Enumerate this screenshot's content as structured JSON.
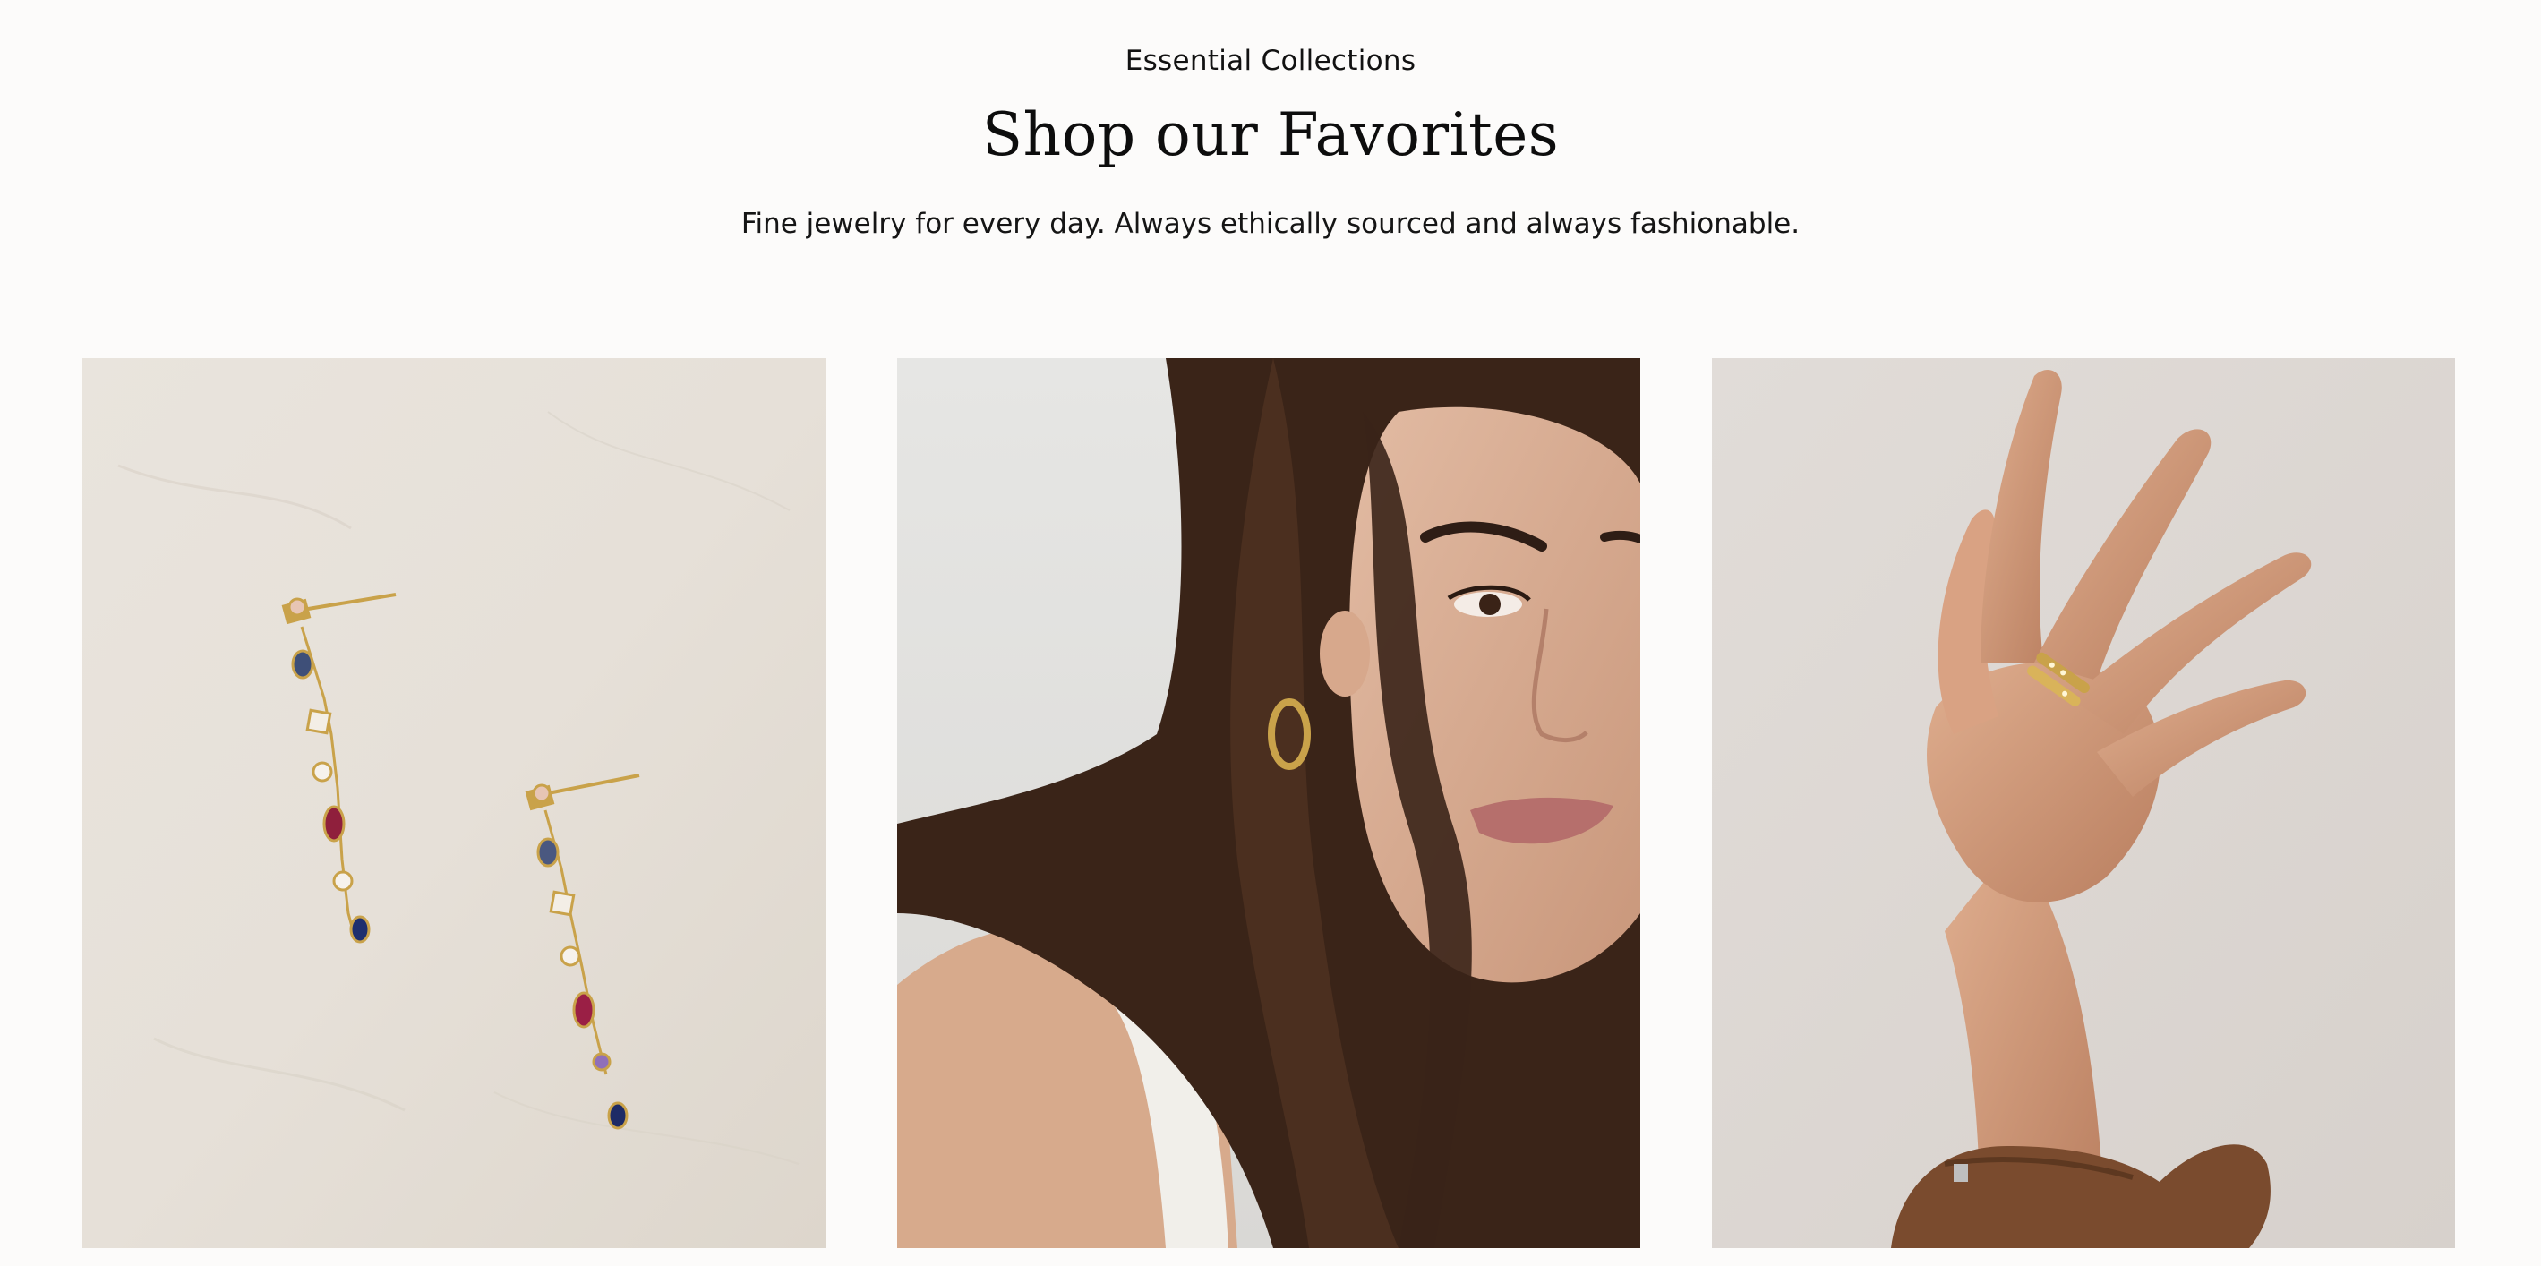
{
  "header": {
    "eyebrow": "Essential Collections",
    "title": "Shop our Favorites",
    "subtitle": "Fine jewelry for every day. Always ethically sourced and always fashionable."
  },
  "colors": {
    "page_background": "#fcfbfa",
    "text": "#111111",
    "gold": "#c9a24a"
  },
  "tiles": [
    {
      "name": "earrings-photo",
      "icon": "drop-earrings-image"
    },
    {
      "name": "model-portrait-photo",
      "icon": "woman-hoop-earring-image"
    },
    {
      "name": "hand-ring-photo",
      "icon": "hand-gold-ring-image"
    }
  ]
}
